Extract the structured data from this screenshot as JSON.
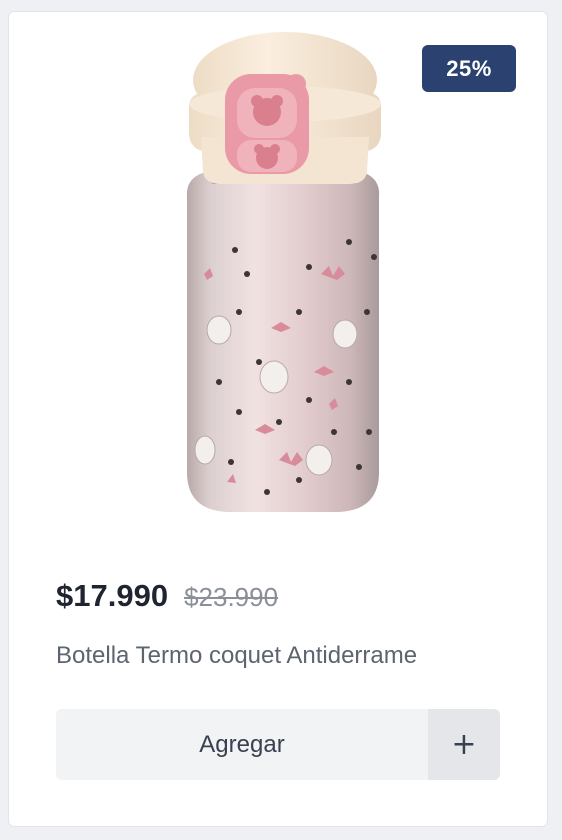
{
  "product": {
    "discount_badge": "25%",
    "price_current": "$17.990",
    "price_old": "$23.990",
    "name": "Botella Termo coquet Antiderrame",
    "image_icon": "thermos-bottle-image"
  },
  "actions": {
    "add_label": "Agregar",
    "plus_label": "+"
  },
  "colors": {
    "badge_bg": "#2b4270",
    "button_bg": "#f2f3f5",
    "plus_bg": "#e4e6ea"
  }
}
